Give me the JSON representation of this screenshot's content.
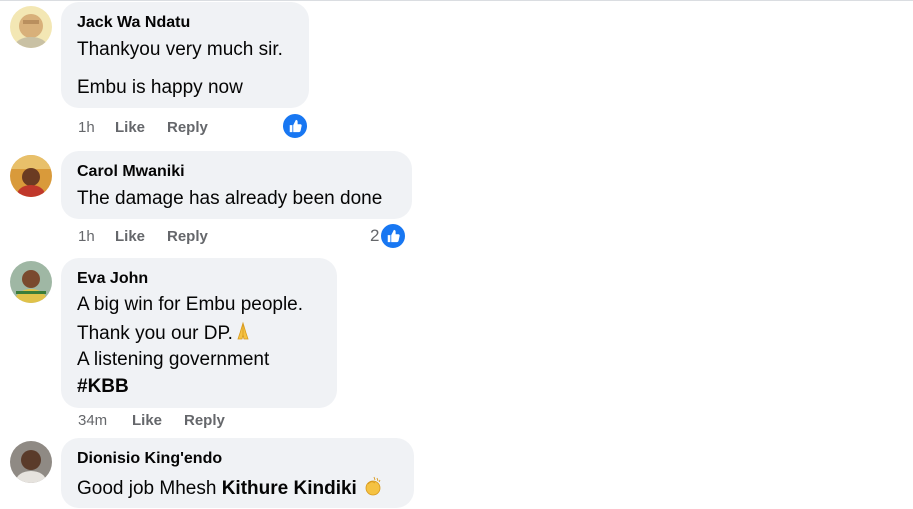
{
  "comments": [
    {
      "author": "Jack Wa Ndatu",
      "lines": [
        "Thankyou very much sir.",
        "Embu is happy now"
      ],
      "time": "1h",
      "like_label": "Like",
      "reply_label": "Reply",
      "reaction": {
        "icon": "like-reaction-icon",
        "count": ""
      }
    },
    {
      "author": "Carol Mwaniki",
      "lines": [
        "The damage has already been done"
      ],
      "time": "1h",
      "like_label": "Like",
      "reply_label": "Reply",
      "reaction": {
        "icon": "like-reaction-icon",
        "count": "2"
      }
    },
    {
      "author": "Eva John",
      "lines": [
        "A big win for Embu people.",
        "Thank you our DP.",
        "A listening government",
        "#KBB"
      ],
      "line2_emoji": "folded-hands-emoji",
      "time": "34m",
      "like_label": "Like",
      "reply_label": "Reply"
    },
    {
      "author": "Dionisio King'endo",
      "line_prefix": "Good job Mhesh ",
      "mention": "Kithure Kindiki",
      "line_emoji": "clapping-hands-emoji"
    }
  ],
  "colors": {
    "bubble": "#f0f2f5",
    "meta": "#65676b",
    "like_blue": "#1877f2"
  }
}
